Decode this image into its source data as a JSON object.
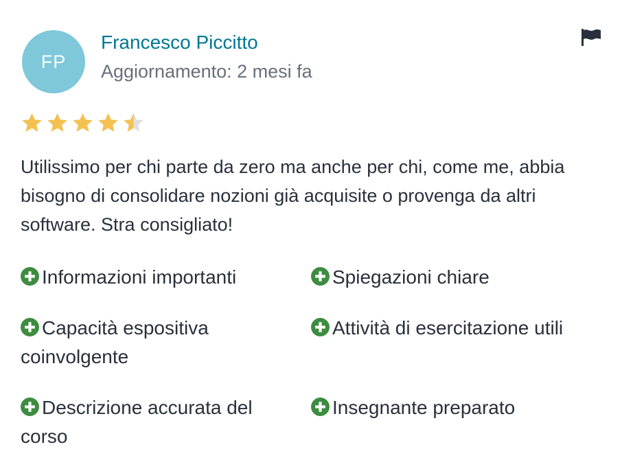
{
  "reviewer": {
    "initials": "FP",
    "name": "Francesco Piccitto",
    "updated": "Aggiornamento: 2 mesi fa"
  },
  "rating": {
    "value": 4.5,
    "max": 5,
    "star_color": "#f4c150",
    "empty_color": "#dedfe0"
  },
  "review": {
    "text": "Utilissimo per chi parte da zero ma anche per chi, come me, abbia bisogno di consolidare nozioni già acquisite o provenga da altri software. Stra consigliato!"
  },
  "tags": [
    "Informazioni importanti",
    "Spiegazioni chiare",
    "Capacità espositiva coinvolgente",
    "Attività di esercitazione utili",
    "Descrizione accurata del corso",
    "Insegnante preparato"
  ],
  "colors": {
    "accent": "#007791",
    "avatar_bg": "#7ec8da",
    "tag_icon": "#3d8c40"
  },
  "icons": {
    "report": "flag-icon",
    "tag": "plus-circle-icon",
    "star": "star-icon"
  }
}
